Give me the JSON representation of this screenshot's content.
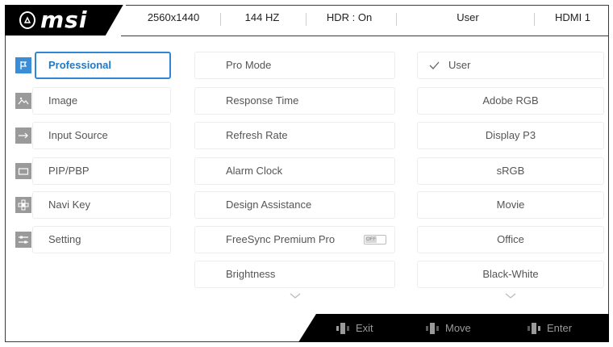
{
  "header": {
    "logo_text": "msi",
    "resolution": "2560x1440",
    "refresh": "144 HZ",
    "hdr": "HDR : On",
    "profile": "User",
    "input": "HDMI 1"
  },
  "main_menu": [
    {
      "label": "Professional",
      "icon": "flag-icon",
      "active": true
    },
    {
      "label": "Image",
      "icon": "image-icon"
    },
    {
      "label": "Input Source",
      "icon": "arrow-right-icon"
    },
    {
      "label": "PIP/PBP",
      "icon": "pip-icon"
    },
    {
      "label": "Navi Key",
      "icon": "navi-key-icon"
    },
    {
      "label": "Setting",
      "icon": "settings-sliders-icon"
    }
  ],
  "sub_menu": [
    {
      "label": "Pro Mode"
    },
    {
      "label": "Response Time"
    },
    {
      "label": "Refresh Rate"
    },
    {
      "label": "Alarm Clock"
    },
    {
      "label": "Design Assistance"
    },
    {
      "label": "FreeSync Premium Pro",
      "toggle": "OFF"
    },
    {
      "label": "Brightness"
    }
  ],
  "mode_options": [
    {
      "label": "User",
      "selected": true
    },
    {
      "label": "Adobe RGB"
    },
    {
      "label": "Display P3"
    },
    {
      "label": "sRGB"
    },
    {
      "label": "Movie"
    },
    {
      "label": "Office"
    },
    {
      "label": "Black-White"
    }
  ],
  "footer": {
    "exit": "Exit",
    "move": "Move",
    "enter": "Enter"
  },
  "colors": {
    "accent": "#2f86d4",
    "frame": "#000000",
    "text": "#555555"
  }
}
